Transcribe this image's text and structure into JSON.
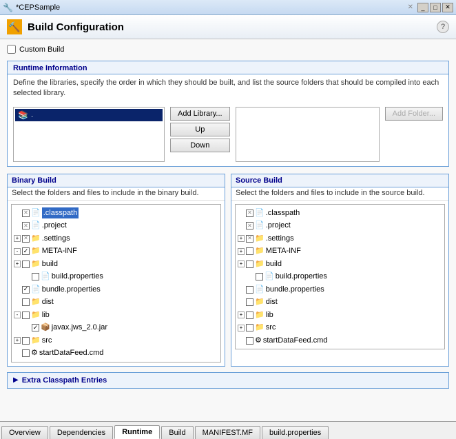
{
  "titleBar": {
    "text": "*CEPSample",
    "closeLabel": "✕"
  },
  "header": {
    "title": "Build Configuration",
    "helpLabel": "?"
  },
  "customBuild": {
    "label": "Custom Build"
  },
  "runtimeInfo": {
    "title": "Runtime Information",
    "description": "Define the libraries, specify the order in which they should be built, and list the source folders that should be compiled into each selected library.",
    "libraryItem": ".",
    "buttons": {
      "addLibrary": "Add Library...",
      "up": "Up",
      "down": "Down",
      "addFolder": "Add Folder..."
    }
  },
  "binaryBuild": {
    "title": "Binary Build",
    "description": "Select the folders and files to include in the binary build.",
    "tree": [
      {
        "indent": 0,
        "expander": "",
        "checkbox": "x",
        "icon": "📄",
        "label": ".classpath",
        "selected": true
      },
      {
        "indent": 0,
        "expander": "",
        "checkbox": "x",
        "icon": "📄",
        "label": ".project",
        "selected": false
      },
      {
        "indent": 0,
        "expander": "+",
        "checkbox": "x",
        "icon": "📁",
        "label": ".settings",
        "selected": false
      },
      {
        "indent": 0,
        "expander": "-",
        "checkbox": "✓",
        "icon": "📁",
        "label": "META-INF",
        "selected": false
      },
      {
        "indent": 0,
        "expander": "+",
        "checkbox": "",
        "icon": "📁",
        "label": "build",
        "selected": false
      },
      {
        "indent": 1,
        "expander": "",
        "checkbox": "",
        "icon": "📄",
        "label": "build.properties",
        "selected": false
      },
      {
        "indent": 0,
        "expander": "",
        "checkbox": "✓",
        "icon": "📄",
        "label": "bundle.properties",
        "selected": false
      },
      {
        "indent": 0,
        "expander": "",
        "checkbox": "",
        "icon": "📁",
        "label": "dist",
        "selected": false
      },
      {
        "indent": 0,
        "expander": "-",
        "checkbox": "",
        "icon": "📁",
        "label": "lib",
        "selected": false
      },
      {
        "indent": 1,
        "expander": "",
        "checkbox": "✓",
        "icon": "📄",
        "label": "javax.jws_2.0.jar",
        "selected": false
      },
      {
        "indent": 0,
        "expander": "+",
        "checkbox": "",
        "icon": "📁",
        "label": "src",
        "selected": false
      },
      {
        "indent": 0,
        "expander": "",
        "checkbox": "",
        "icon": "📄",
        "label": "startDataFeed.cmd",
        "selected": false
      }
    ]
  },
  "sourceBuild": {
    "title": "Source Build",
    "description": "Select the folders and files to include in the source build.",
    "tree": [
      {
        "indent": 0,
        "expander": "",
        "checkbox": "x",
        "icon": "📄",
        "label": ".classpath",
        "selected": false
      },
      {
        "indent": 0,
        "expander": "",
        "checkbox": "x",
        "icon": "📄",
        "label": ".project",
        "selected": false
      },
      {
        "indent": 0,
        "expander": "+",
        "checkbox": "x",
        "icon": "📁",
        "label": ".settings",
        "selected": false
      },
      {
        "indent": 0,
        "expander": "+",
        "checkbox": "",
        "icon": "📁",
        "label": "META-INF",
        "selected": false
      },
      {
        "indent": 0,
        "expander": "+",
        "checkbox": "",
        "icon": "📁",
        "label": "build",
        "selected": false
      },
      {
        "indent": 1,
        "expander": "",
        "checkbox": "",
        "icon": "📄",
        "label": "build.properties",
        "selected": false
      },
      {
        "indent": 0,
        "expander": "",
        "checkbox": "",
        "icon": "📄",
        "label": "bundle.properties",
        "selected": false
      },
      {
        "indent": 0,
        "expander": "",
        "checkbox": "",
        "icon": "📁",
        "label": "dist",
        "selected": false
      },
      {
        "indent": 0,
        "expander": "+",
        "checkbox": "",
        "icon": "📁",
        "label": "lib",
        "selected": false
      },
      {
        "indent": 0,
        "expander": "+",
        "checkbox": "",
        "icon": "📁",
        "label": "src",
        "selected": false
      },
      {
        "indent": 0,
        "expander": "",
        "checkbox": "",
        "icon": "📄",
        "label": "startDataFeed.cmd",
        "selected": false
      }
    ]
  },
  "extraClasspath": {
    "label": "Extra Classpath Entries"
  },
  "tabs": [
    {
      "label": "Overview",
      "active": false
    },
    {
      "label": "Dependencies",
      "active": false
    },
    {
      "label": "Runtime",
      "active": true
    },
    {
      "label": "Build",
      "active": false
    },
    {
      "label": "MANIFEST.MF",
      "active": false
    },
    {
      "label": "build.properties",
      "active": false
    }
  ]
}
